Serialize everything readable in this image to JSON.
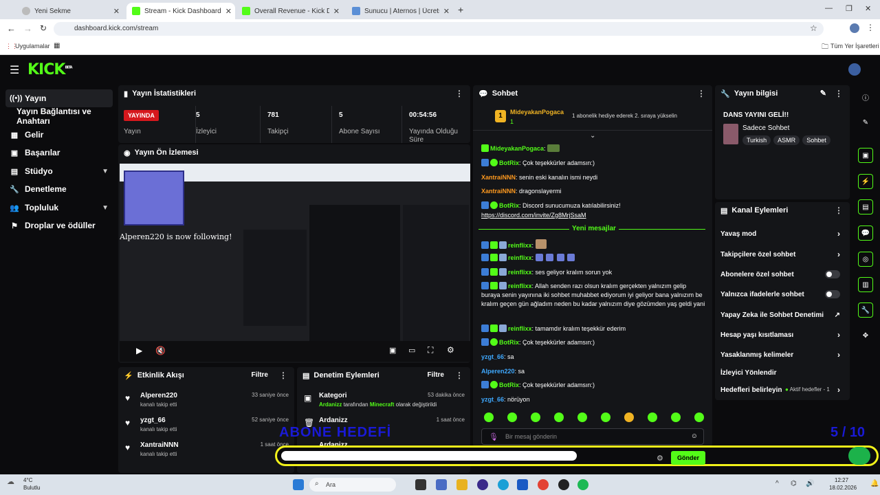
{
  "browser": {
    "tabs": [
      {
        "label": "Yeni Sekme"
      },
      {
        "label": "Stream - Kick Dashboard"
      },
      {
        "label": "Overall Revenue - Kick Dashbo"
      },
      {
        "label": "Sunucu | Aternos | Ücretsiz Min"
      }
    ],
    "url": "dashboard.kick.com/stream",
    "bookmarks_left": "Uygulamalar",
    "bookmarks_right": "Tüm Yer İşaretleri"
  },
  "app": {
    "logo": "KICK",
    "logo_sup": "BETA",
    "accent": "#53fc18"
  },
  "sidebar": {
    "items": [
      {
        "label": "Yayın",
        "icon": "broadcast-icon"
      },
      {
        "label": "Yayın Bağlantısı ve Anahtarı",
        "icon": ""
      },
      {
        "label": "Gelir",
        "icon": "revenue-icon"
      },
      {
        "label": "Başarılar",
        "icon": "achievements-icon"
      },
      {
        "label": "Stüdyo",
        "icon": "studio-icon"
      },
      {
        "label": "Denetleme",
        "icon": "wrench-icon"
      },
      {
        "label": "Topluluk",
        "icon": "community-icon"
      },
      {
        "label": "Droplar ve ödüller",
        "icon": "gift-icon"
      }
    ]
  },
  "stats": {
    "title": "Yayın İstatistikleri",
    "live_badge": "YAYINDA",
    "live_label": "Yayın",
    "items": [
      {
        "value": "5",
        "label": "İzleyici"
      },
      {
        "value": "781",
        "label": "Takipçi"
      },
      {
        "value": "5",
        "label": "Abone Sayısı"
      },
      {
        "value": "00:54:56",
        "label": "Yayında Olduğu Süre"
      }
    ]
  },
  "preview": {
    "title": "Yayın Ön İzlemesi",
    "overlay_text": "is now following!",
    "overlay_user": "Alperen220"
  },
  "activity": {
    "title": "Etkinlik Akışı",
    "filter": "Filtre",
    "items": [
      {
        "name": "Alperen220",
        "sub": "kanalı takip etti",
        "time": "33 saniye önce"
      },
      {
        "name": "yzgt_66",
        "sub": "kanalı takip etti",
        "time": "52 saniye önce"
      },
      {
        "name": "XantraiNNN",
        "sub": "kanalı takip etti",
        "time": "1 saat önce"
      }
    ]
  },
  "moderation": {
    "title": "Denetim Eylemleri",
    "filter": "Filtre",
    "items": [
      {
        "title": "Kategori",
        "user": "Ardanizz",
        "mid": " tarafından ",
        "cat": "Minecraft",
        "tail": " olarak değiştirildi",
        "time": "53 dakika önce"
      },
      {
        "title": "Ardanizz",
        "sub": "",
        "time": "1 saat önce"
      },
      {
        "title": "Ardanizz",
        "sub": "",
        "time": ""
      }
    ]
  },
  "chat": {
    "title": "Sohbet",
    "pinned_user": "MideyakanPogaca",
    "pinned_count": "1",
    "pinned_rank": "1",
    "pinned_text": "1 abonelik hediye ederek 2. sıraya yükselin",
    "new_messages": "Yeni mesajlar",
    "input_placeholder": "Bir mesaj gönderin",
    "send": "Gönder",
    "messages": [
      {
        "user": "MideyakanPogaca",
        "color": "#53fc18",
        "text": ""
      },
      {
        "user": "BotRix",
        "color": "#53fc18",
        "text": "Çok teşekkürler adamsın:)"
      },
      {
        "user": "XantraiNNN",
        "color": "#ff9a1f",
        "text": "senin eski kanalın ismi neydi"
      },
      {
        "user": "XantraiNNN",
        "color": "#ff9a1f",
        "text": "dragonslayermi"
      },
      {
        "user": "BotRix",
        "color": "#53fc18",
        "text": "Discord sunucumuza katılabilirsiniz!"
      },
      {
        "user": "",
        "color": "#fff",
        "text": "https://discord.com/invite/Zg8MrjSsaM"
      },
      {
        "user": "reinflixx",
        "color": "#53fc18",
        "text": ""
      },
      {
        "user": "reinflixx",
        "color": "#53fc18",
        "text": ""
      },
      {
        "user": "reinflixx",
        "color": "#53fc18",
        "text": "ses geliyor kralım sorun yok"
      },
      {
        "user": "reinflixx",
        "color": "#53fc18",
        "text": "Allah senden razı olsun kralım gerçekten yalnızım gelip buraya senin yayınına iki sohbet muhabbet ediyorum iyi geliyor bana yalnızım be kralım geçen gün ağladım neden bu kadar yalnızım diye gözümden yaş geldi yani"
      },
      {
        "user": "reinflixx",
        "color": "#53fc18",
        "text": "tamamdır kralım teşekkür ederim"
      },
      {
        "user": "BotRix",
        "color": "#53fc18",
        "text": "Çok teşekkürler adamsın:)"
      },
      {
        "user": "yzgt_66",
        "color": "#3fa9ff",
        "text": "sa"
      },
      {
        "user": "Alperen220",
        "color": "#3fa9ff",
        "text": "sa"
      },
      {
        "user": "BotRix",
        "color": "#53fc18",
        "text": "Çok teşekkürler adamsın:)"
      },
      {
        "user": "yzgt_66",
        "color": "#3fa9ff",
        "text": "nörüyon"
      }
    ]
  },
  "info": {
    "title": "Yayın bilgisi",
    "stream_title": "DANS YAYINI GELİ!!",
    "category": "Sadece Sohbet",
    "tags": [
      "Turkish",
      "ASMR",
      "Sohbet"
    ]
  },
  "channel_actions": {
    "title": "Kanal Eylemleri",
    "items": [
      {
        "label": "Yavaş mod",
        "kind": "chev"
      },
      {
        "label": "Takipçilere özel sohbet",
        "kind": "chev"
      },
      {
        "label": "Abonelere özel sohbet",
        "kind": "toggle"
      },
      {
        "label": "Yalnızca ifadelerle sohbet",
        "kind": "toggle"
      },
      {
        "label": "Yapay Zeka ile Sohbet Denetimi",
        "kind": "ext"
      },
      {
        "label": "Hesap yaşı kısıtlaması",
        "kind": "chev"
      },
      {
        "label": "Yasaklanmış kelimeler",
        "kind": "chev"
      },
      {
        "label": "İzleyici Yönlendir",
        "kind": ""
      },
      {
        "label": "Hedefleri belirleyin",
        "kind": "chev",
        "extra": "Aktif hedefler - 1"
      }
    ]
  },
  "overlay_goal": {
    "label": "ABONE HEDEFİ",
    "current": "5",
    "sep": "/",
    "target": "10",
    "progress": 0.5
  },
  "taskbar": {
    "weather_temp": "4°C",
    "weather_desc": "Bulutlu",
    "search": "Ara",
    "time": "12:27",
    "date": "18.02.2026"
  }
}
